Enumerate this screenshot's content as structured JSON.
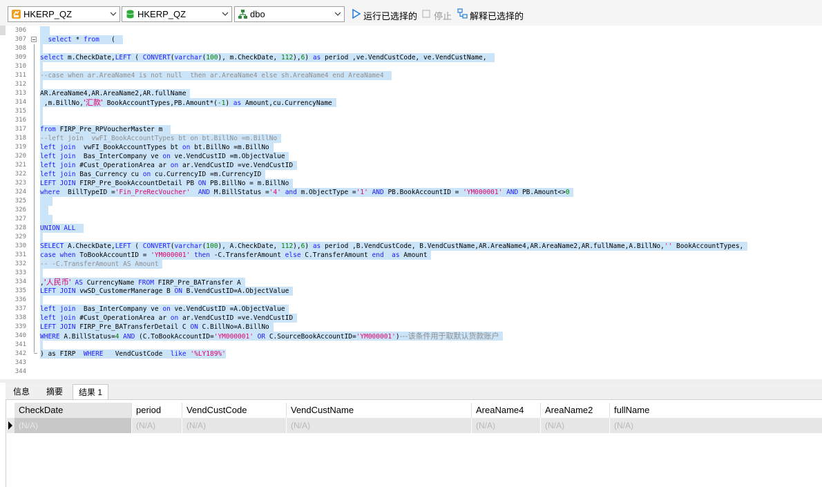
{
  "toolbar": {
    "connection": "HKERP_QZ",
    "database": "HKERP_QZ",
    "schema": "dbo",
    "run_selected": "运行已选择的",
    "stop": "停止",
    "explain_selected": "解释已选择的"
  },
  "colors": {
    "selection": "#cce4f7",
    "keyword": "#1a1aff",
    "string": "#e0006a",
    "number": "#008000",
    "comment": "#8f8f8f",
    "run_icon": "#1e7fd8"
  },
  "editor": {
    "line_numbers": [
      "306",
      "307",
      "308",
      "309",
      "310",
      "311",
      "312",
      "313",
      "314",
      "315",
      "316",
      "317",
      "318",
      "319",
      "320",
      "321",
      "322",
      "323",
      "324",
      "325",
      "326",
      "327",
      "328",
      "329",
      "330",
      "331",
      "332",
      "333",
      "334",
      "335",
      "336",
      "337",
      "338",
      "339",
      "340",
      "341",
      "342",
      "343",
      "344"
    ],
    "lines": {
      "l307": {
        "a": "select",
        "b": " * ",
        "c": "from",
        "d": "   ("
      },
      "l309": {
        "a": "select",
        "b": " m.CheckDate,",
        "c": "LEFT",
        "d": " ( ",
        "e": "CONVERT",
        "f": "(",
        "g": "varchar",
        "h": "(",
        "i": "100",
        "j": "), m.CheckDate, ",
        "k": "112",
        "l": "),",
        "m": "6",
        "n": ") ",
        "o": "as",
        "p": " period ,ve.VendCustCode, ve.VendCustName,"
      },
      "l311": {
        "a": "--case when ar.AreaName4 is not null  then ar.AreaName4 else sh.AreaName4 end AreaName4"
      },
      "l313": {
        "a": "AR.AreaName4,AR.AreaName2,AR.fullName"
      },
      "l314": {
        "a": " ,m.BillNo,",
        "b": "'汇款'",
        "c": " BookAccountTypes,PB.Amount*(",
        "d": "-1",
        "e": ") ",
        "f": "as",
        "g": " Amount,cu.CurrencyName"
      },
      "l317": {
        "a": "from",
        "b": " FIRP_Pre_RPVoucherMaster m"
      },
      "l318": {
        "a": "--left join  vwFI_BookAccountTypes bt on bt.BillNo =m.BillNo"
      },
      "l319": {
        "a": "left join",
        "b": "  vwFI_BookAccountTypes bt ",
        "c": "on",
        "d": " bt.BillNo =m.BillNo"
      },
      "l320": {
        "a": "left join",
        "b": "  Bas_InterCompany ve ",
        "c": "on",
        "d": " ve.VendCustID =m.ObjectValue"
      },
      "l321": {
        "a": "left join",
        "b": " #Cust_OperationArea ar ",
        "c": "on",
        "d": " ar.VendCustID =ve.VendCustID"
      },
      "l322": {
        "a": "left join",
        "b": " Bas_Currency cu ",
        "c": "on",
        "d": " cu.CurrencyID =m.CurrencyID"
      },
      "l323": {
        "a": "LEFT JOIN",
        "b": " FIRP_Pre_BookAccountDetail PB ",
        "c": "ON",
        "d": " PB.BillNo = m.BillNo"
      },
      "l324": {
        "a": "where",
        "b": "  BillTypeID =",
        "c": "'Fin_PreRecVoucher'",
        "d": "  ",
        "e": "AND",
        "f": " M.BillStatus =",
        "g": "'4'",
        "h": " ",
        "i": "and",
        "j": " m.ObjectType =",
        "k": "'1'",
        "l": " ",
        "m": "AND",
        "n": " PB.BookAccountID = ",
        "o": "'YM000001'",
        "p": " ",
        "q": "AND",
        "r": " PB.Amount<>",
        "s": "0"
      },
      "l328": {
        "a": "UNION ALL"
      },
      "l330": {
        "a": "SELECT",
        "b": " A.CheckDate,",
        "c": "LEFT",
        "d": " ( ",
        "e": "CONVERT",
        "f": "(",
        "g": "varchar",
        "h": "(",
        "i": "100",
        "j": "), A.CheckDate, ",
        "k": "112",
        "l": "),",
        "m": "6",
        "n": ") ",
        "o": "as",
        "p": " period ,B.VendCustCode, B.VendCustName,AR.AreaName4,AR.AreaName2,AR.fullName,A.BillNo,",
        "q": "''",
        "r": " BookAccountTypes,"
      },
      "l331": {
        "a": "case when",
        "b": " ToBookAccountID = ",
        "c": "'YM000001'",
        "d": " ",
        "e": "then",
        "f": " -C.TransferAmount ",
        "g": "else",
        "h": " C.TransferAmount ",
        "i": "end",
        "j": "  ",
        "k": "as",
        "l": " Amount "
      },
      "l332": {
        "a": "-- -C.TransferAmount AS Amount"
      },
      "l334": {
        "a": ",",
        "b": "'人民币'",
        "c": " ",
        "d": "AS",
        "e": " CurrencyName ",
        "f": "FROM",
        "g": " FIRP_Pre_BATransfer A"
      },
      "l335": {
        "a": "LEFT JOIN",
        "b": " vwSD_CustomerManerage B ",
        "c": "ON",
        "d": " B.VendCustID=A.ObjectValue"
      },
      "l337": {
        "a": "left join",
        "b": "  Bas_InterCompany ve ",
        "c": "on",
        "d": " ve.VendCustID =A.ObjectValue"
      },
      "l338": {
        "a": "left join",
        "b": " #Cust_OperationArea ar ",
        "c": "on",
        "d": " ar.VendCustID =ve.VendCustID"
      },
      "l339": {
        "a": "LEFT JOIN",
        "b": " FIRP_Pre_BATransferDetail C ",
        "c": "ON",
        "d": " C.BillNo=A.BillNo"
      },
      "l340": {
        "a": "WHERE",
        "b": " A.BillStatus=",
        "c": "4",
        "d": " ",
        "e": "AND",
        "f": " (C.ToBookAccountID=",
        "g": "'YM000001'",
        "h": " ",
        "i": "OR",
        "j": " C.SourceBookAccountID=",
        "k": "'YM000001'",
        "l": ")",
        "m": "---该条件用于取默认货款账户"
      },
      "l342": {
        "a": ") as FIRP  ",
        "b": "WHERE",
        "c": "   VendCustCode  ",
        "d": "like",
        "e": " ",
        "f": "'%LY189%'"
      }
    }
  },
  "results": {
    "tabs": [
      "信息",
      "摘要",
      "结果 1"
    ],
    "active_tab": "结果 1",
    "columns": [
      "CheckDate",
      "period",
      "VendCustCode",
      "VendCustName",
      "AreaName4",
      "AreaName2",
      "fullName"
    ],
    "row": [
      "(N/A)",
      "(N/A)",
      "(N/A)",
      "(N/A)",
      "(N/A)",
      "(N/A)",
      "(N/A)"
    ]
  }
}
